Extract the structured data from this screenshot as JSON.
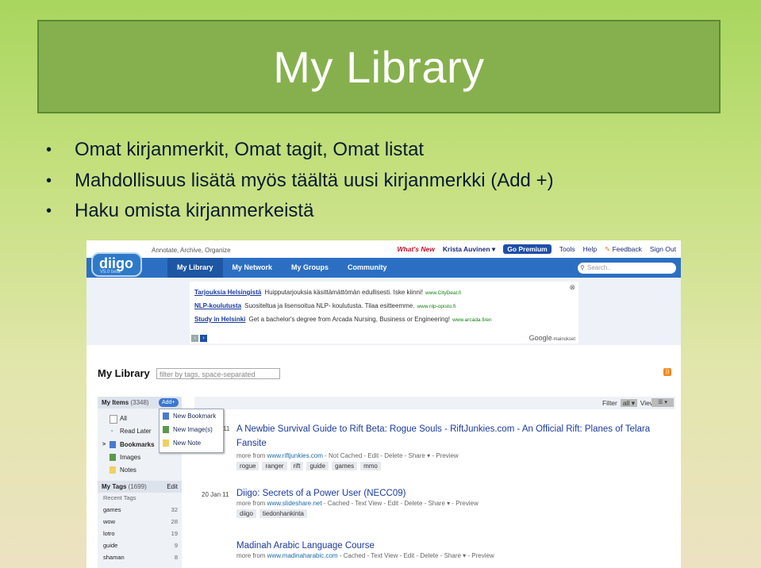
{
  "slide": {
    "title": "My Library",
    "bullets": [
      "Omat kirjanmerkit, Omat tagit, Omat listat",
      "Mahdollisuus lisätä myös täältä uusi kirjanmerkki (Add +)",
      "Haku omista kirjanmerkeistä"
    ]
  },
  "app": {
    "logo": "diigo",
    "logo_version": "V5.0 beta",
    "tagline": "Annotate, Archive, Organize",
    "top_links": {
      "whats_new": "What's New",
      "user": "Krista Auvinen ▾",
      "premium": "Go Premium",
      "tools": "Tools",
      "help": "Help",
      "feedback": "Feedback",
      "signout": "Sign Out"
    },
    "nav_tabs": [
      "My Library",
      "My Network",
      "My Groups",
      "Community"
    ],
    "search_placeholder": "Search..",
    "ads": [
      {
        "headline": "Tarjouksia Helsingistä",
        "text": "Huipputarjouksia käsittämättömän edullisesti. Iske kiinni!",
        "url": "www.CityDeal.fi"
      },
      {
        "headline": "NLP-koulutusta",
        "text": "Suositeltua ja lisensoitua NLP- koulutusta. Tilaa esitteemme.",
        "url": "www.nlp-opisto.fi"
      },
      {
        "headline": "Study in Helsinki",
        "text": "Get a bachelor's degree from Arcada Nursing, Business or Engineering!",
        "url": "www.arcada.fi/en"
      }
    ],
    "ads_brand": "Google",
    "ads_brand_suffix": "-mainokset",
    "library_title": "My Library",
    "filter_placeholder": "filter by tags, space-separated",
    "sidebar": {
      "my_items_label": "My Items",
      "my_items_count": "(3348)",
      "add_label": "Add+",
      "items": [
        "All",
        "Read Later",
        "Bookmarks",
        "Images",
        "Notes"
      ],
      "my_tags_label": "My Tags",
      "my_tags_count": "(1699)",
      "edit_label": "Edit",
      "recent_tags_label": "Recent Tags",
      "tags": [
        {
          "name": "games",
          "count": "32"
        },
        {
          "name": "wow",
          "count": "28"
        },
        {
          "name": "lotro",
          "count": "19"
        },
        {
          "name": "guide",
          "count": "9"
        },
        {
          "name": "shaman",
          "count": "8"
        }
      ]
    },
    "add_menu": [
      "New Bookmark",
      "New Image(s)",
      "New Note"
    ],
    "filter_bar": {
      "filter_label": "Filter",
      "filter_value": "all ▾",
      "view_label": "View",
      "view_value": "☰ ▾"
    },
    "bookmarks": [
      {
        "date": "11",
        "title": "A Newbie Survival Guide to Rift Beta: Rogue Souls - RiftJunkies.com - An Official Rift: Planes of Telara Fansite",
        "meta_prefix": "more from ",
        "source": "www.riftjunkies.com",
        "meta_suffix": " - Not Cached - Edit - Delete - Share ▾ - Preview",
        "tags": [
          "rogue",
          "ranger",
          "rift",
          "guide",
          "games",
          "mmo"
        ]
      },
      {
        "date": "20 Jan 11",
        "title": "Diigo: Secrets of a Power User (NECC09)",
        "meta_prefix": "more from ",
        "source": "www.slideshare.net",
        "meta_suffix": " - Cached - Text View - Edit - Delete - Share ▾ - Preview",
        "tags": [
          "diigo",
          "tiedonhankinta"
        ]
      },
      {
        "date": "",
        "title": "Madinah Arabic Language Course",
        "meta_prefix": "more from ",
        "source": "www.madinaharabic.com",
        "meta_suffix": " - Cached - Text View - Edit - Delete - Share ▾ - Preview",
        "tags": []
      }
    ]
  }
}
